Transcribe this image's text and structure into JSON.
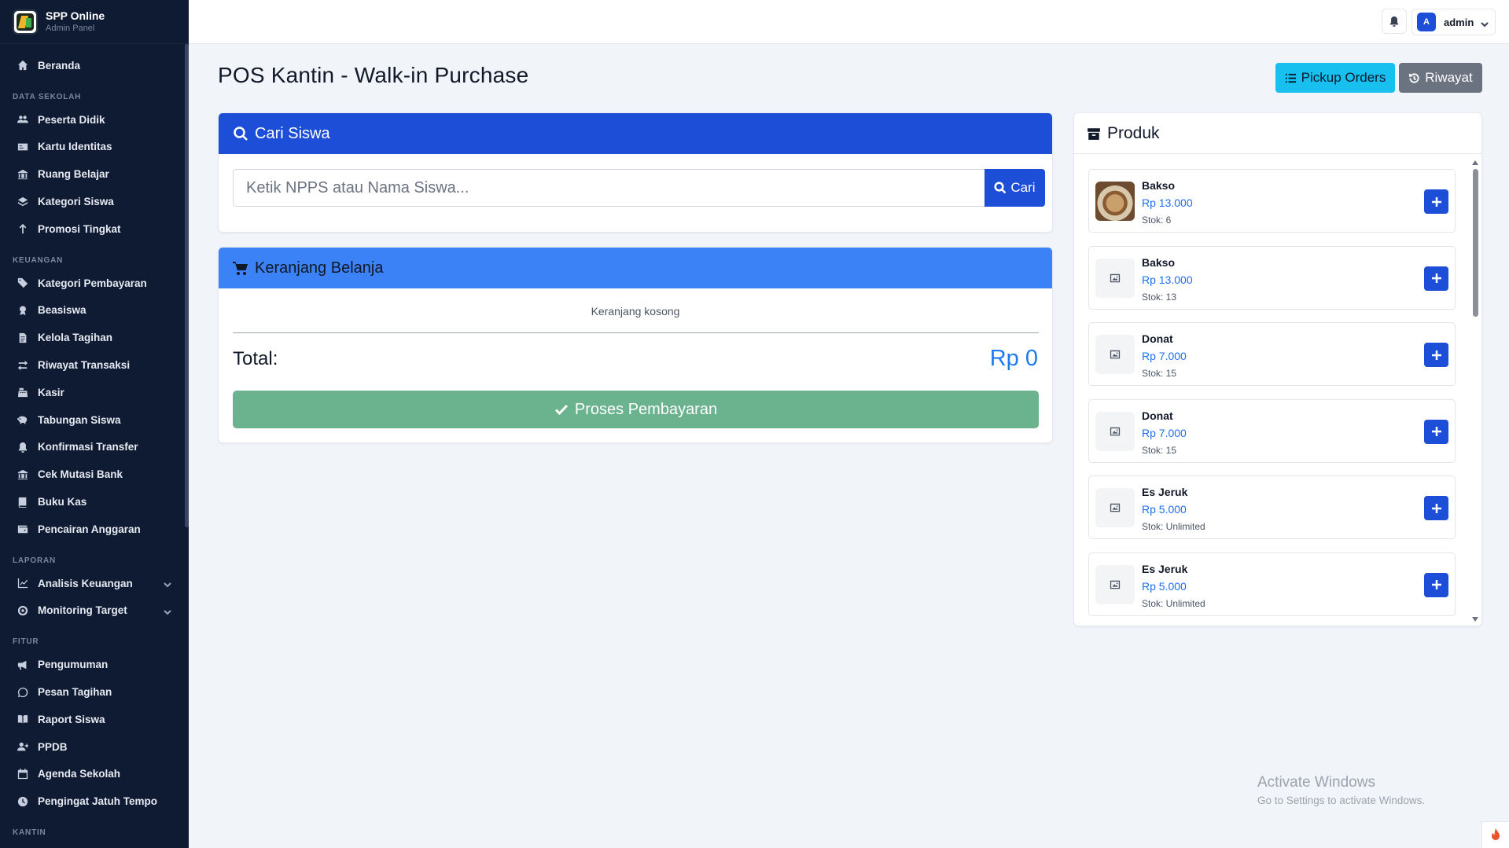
{
  "brand": {
    "title": "SPP Online",
    "subtitle": "Admin Panel"
  },
  "sidebar": {
    "home": "Beranda",
    "sections": [
      {
        "title": "DATA SEKOLAH",
        "items": [
          "Peserta Didik",
          "Kartu Identitas",
          "Ruang Belajar",
          "Kategori Siswa",
          "Promosi Tingkat"
        ]
      },
      {
        "title": "KEUANGAN",
        "items": [
          "Kategori Pembayaran",
          "Beasiswa",
          "Kelola Tagihan",
          "Riwayat Transaksi",
          "Kasir",
          "Tabungan Siswa",
          "Konfirmasi Transfer",
          "Cek Mutasi Bank",
          "Buku Kas",
          "Pencairan Anggaran"
        ]
      },
      {
        "title": "LAPORAN",
        "items": [
          "Analisis Keuangan",
          "Monitoring Target"
        ]
      },
      {
        "title": "FITUR",
        "items": [
          "Pengumuman",
          "Pesan Tagihan",
          "Raport Siswa",
          "PPDB",
          "Agenda Sekolah",
          "Pengingat Jatuh Tempo"
        ]
      },
      {
        "title": "KANTIN",
        "items": []
      }
    ]
  },
  "topbar": {
    "avatar_letter": "A",
    "user_name": "admin"
  },
  "page": {
    "title": "POS Kantin - Walk-in Purchase",
    "pickup_label": "Pickup Orders",
    "riwayat_label": "Riwayat"
  },
  "search": {
    "title": "Cari Siswa",
    "placeholder": "Ketik NPPS atau Nama Siswa...",
    "button_label": "Cari"
  },
  "cart": {
    "title": "Keranjang Belanja",
    "empty_text": "Keranjang kosong",
    "total_label": "Total:",
    "total_value": "Rp 0",
    "pay_label": "Proses Pembayaran"
  },
  "products": {
    "title": "Produk",
    "items": [
      {
        "name": "Bakso",
        "price": "Rp 13.000",
        "stock": "Stok: 6"
      },
      {
        "name": "Bakso",
        "price": "Rp 13.000",
        "stock": "Stok: 13"
      },
      {
        "name": "Donat",
        "price": "Rp 7.000",
        "stock": "Stok: 15"
      },
      {
        "name": "Donat",
        "price": "Rp 7.000",
        "stock": "Stok: 15"
      },
      {
        "name": "Es Jeruk",
        "price": "Rp 5.000",
        "stock": "Stok: Unlimited"
      },
      {
        "name": "Es Jeruk",
        "price": "Rp 5.000",
        "stock": "Stok: Unlimited"
      }
    ]
  },
  "watermark": {
    "line1": "Activate Windows",
    "line2": "Go to Settings to activate Windows."
  },
  "colors": {
    "primary": "#1d4ed8",
    "cart_header": "#3b82f6",
    "sidebar_bg": "#0f1b33",
    "pickup": "#17c0ef",
    "pay": "#6bb28f"
  }
}
